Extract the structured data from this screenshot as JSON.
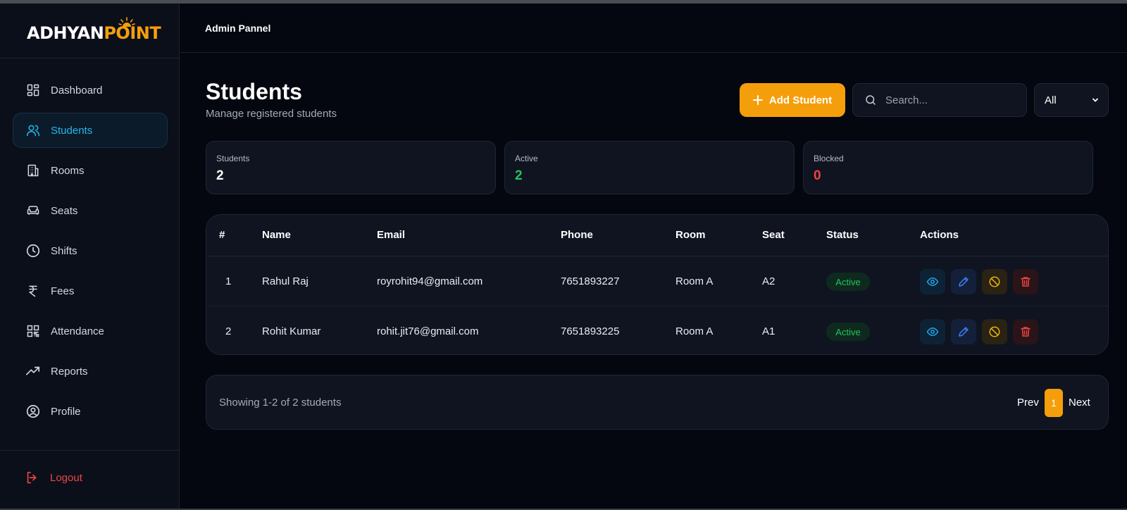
{
  "brand": {
    "logo_white": "ADHYAN",
    "logo_orange": "POINT"
  },
  "header": {
    "title": "Admin Pannel"
  },
  "sidebar": {
    "items": [
      {
        "label": "Dashboard",
        "icon": "dashboard-icon"
      },
      {
        "label": "Students",
        "icon": "users-icon",
        "active": true
      },
      {
        "label": "Rooms",
        "icon": "building-icon"
      },
      {
        "label": "Seats",
        "icon": "sofa-icon"
      },
      {
        "label": "Shifts",
        "icon": "clock-icon"
      },
      {
        "label": "Fees",
        "icon": "rupee-icon"
      },
      {
        "label": "Attendance",
        "icon": "qr-code-icon"
      },
      {
        "label": "Reports",
        "icon": "trending-icon"
      },
      {
        "label": "Profile",
        "icon": "user-circle-icon"
      }
    ],
    "logout_label": "Logout"
  },
  "page": {
    "title": "Students",
    "subtitle": "Manage registered students"
  },
  "toolbar": {
    "add_label": "Add Student",
    "search_placeholder": "Search...",
    "filter_value": "All"
  },
  "stats": [
    {
      "label": "Students",
      "value": "2",
      "color": "#ffffff"
    },
    {
      "label": "Active",
      "value": "2",
      "color": "#22c55e"
    },
    {
      "label": "Blocked",
      "value": "0",
      "color": "#ef4444"
    }
  ],
  "table": {
    "headers": [
      "#",
      "Name",
      "Email",
      "Phone",
      "Room",
      "Seat",
      "Status",
      "Actions"
    ],
    "rows": [
      {
        "num": "1",
        "name": "Rahul Raj",
        "email": "royrohit94@gmail.com",
        "phone": "7651893227",
        "room": "Room A",
        "seat": "A2",
        "status": "Active"
      },
      {
        "num": "2",
        "name": "Rohit Kumar",
        "email": "rohit.jit76@gmail.com",
        "phone": "7651893225",
        "room": "Room A",
        "seat": "A1",
        "status": "Active"
      }
    ]
  },
  "pagination": {
    "info": "Showing 1-2 of 2 students",
    "prev": "Prev",
    "page": "1",
    "next": "Next"
  },
  "colors": {
    "accent": "#f59e0b",
    "active_nav": "#22b8ee",
    "success": "#22c55e",
    "danger": "#ef4444"
  }
}
